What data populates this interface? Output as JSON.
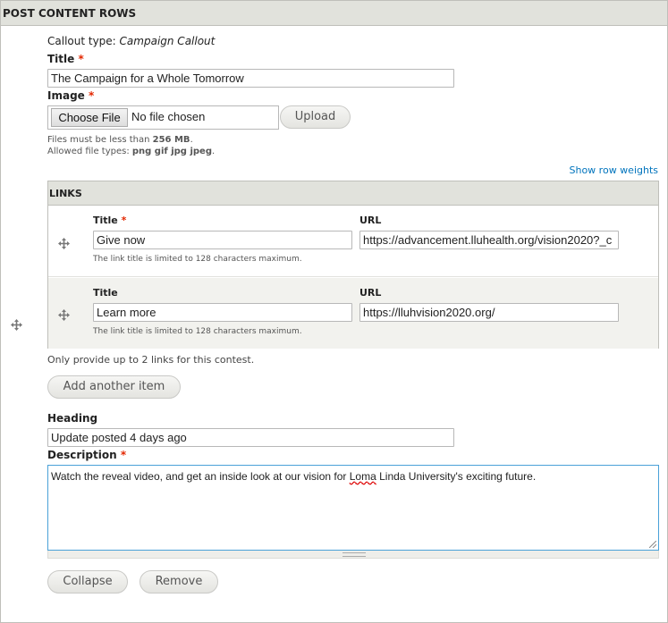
{
  "section": {
    "title": "POST CONTENT ROWS"
  },
  "callout": {
    "label": "Callout type:",
    "value": "Campaign Callout"
  },
  "title_field": {
    "label": "Title",
    "required_mark": "*",
    "value": "The Campaign for a Whole Tomorrow"
  },
  "image_field": {
    "label": "Image",
    "required_mark": "*",
    "choose_label": "Choose File",
    "no_file_text": "No file chosen",
    "upload_label": "Upload",
    "size_text_prefix": "Files must be less than ",
    "size_limit": "256 MB",
    "size_text_suffix": ".",
    "types_prefix": "Allowed file types: ",
    "types": "png gif jpg jpeg",
    "types_suffix": "."
  },
  "row_weights_link": "Show row weights",
  "links": {
    "header": "LINKS",
    "rows": [
      {
        "title_label": "Title",
        "required_mark": "*",
        "url_label": "URL",
        "title_value": "Give now",
        "url_value": "https://advancement.lluhealth.org/vision2020?_c",
        "description": "The link title is limited to 128 characters maximum."
      },
      {
        "title_label": "Title",
        "url_label": "URL",
        "title_value": "Learn more",
        "url_value": "https://lluhvision2020.org/",
        "description": "The link title is limited to 128 characters maximum."
      }
    ],
    "note": "Only provide up to 2 links for this contest.",
    "add_label": "Add another item"
  },
  "heading_field": {
    "label": "Heading",
    "value": "Update posted 4 days ago"
  },
  "description_field": {
    "label": "Description",
    "required_mark": "*",
    "value_before": "Watch the reveal video, and get an inside look at our vision for ",
    "value_misspelled": "Loma",
    "value_after": " Linda University's exciting future."
  },
  "actions": {
    "collapse_label": "Collapse",
    "remove_label": "Remove"
  },
  "icons": {
    "drag": "drag-handle-icon"
  },
  "colors": {
    "required": "#e32700",
    "link": "#0074bd",
    "focus_border": "#4aa1d8",
    "header_bg": "#e1e2dc"
  }
}
